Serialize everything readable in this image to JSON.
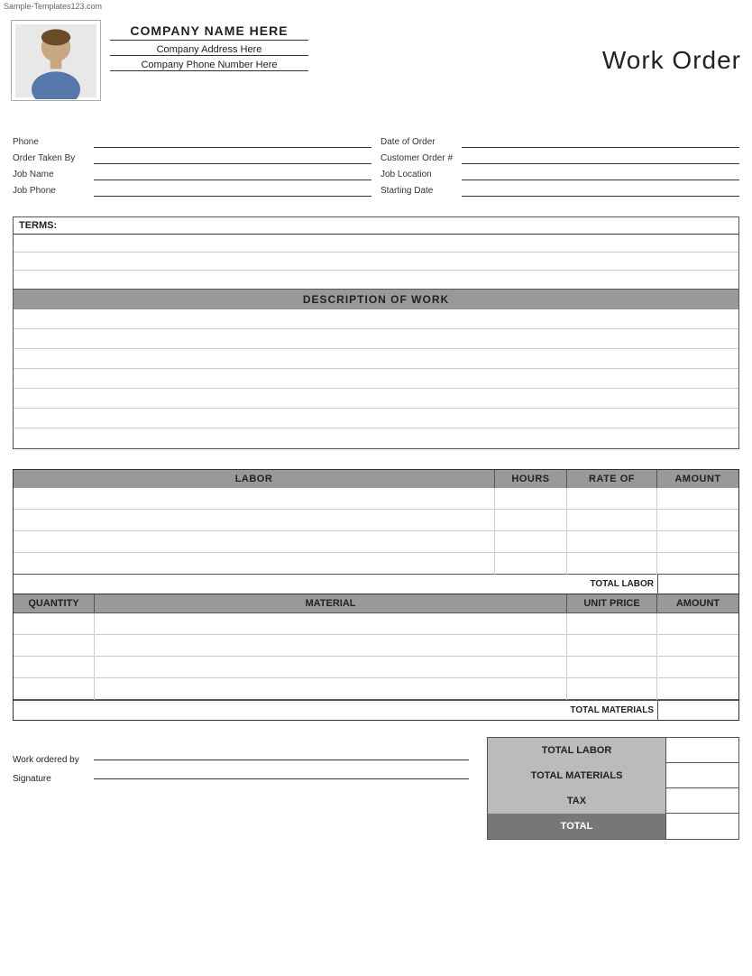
{
  "watermark": "Sample-Templates123.com",
  "header": {
    "company_name": "COMPANY NAME HERE",
    "company_address": "Company Address Here",
    "company_phone": "Company Phone Number Here",
    "title": "Work Order"
  },
  "form": {
    "left": [
      {
        "label": "Phone",
        "value": ""
      },
      {
        "label": "Order Taken By",
        "value": ""
      },
      {
        "label": "Job Name",
        "value": ""
      },
      {
        "label": "Job Phone",
        "value": ""
      }
    ],
    "right": [
      {
        "label": "Date of Order",
        "value": ""
      },
      {
        "label": "Customer Order #",
        "value": ""
      },
      {
        "label": "Job Location",
        "value": ""
      },
      {
        "label": "Starting Date",
        "value": ""
      }
    ]
  },
  "terms": {
    "label": "TERMS:",
    "rows": 3
  },
  "description": {
    "header": "DESCRIPTION OF WORK",
    "rows": 7
  },
  "labor": {
    "columns": [
      "LABOR",
      "HOURS",
      "RATE OF",
      "AMOUNT"
    ],
    "rows": 4,
    "total_label": "TOTAL LABOR"
  },
  "materials": {
    "columns": [
      "QUANTITY",
      "MATERIAL",
      "UNIT PRICE",
      "AMOUNT"
    ],
    "rows": 4,
    "total_label": "TOTAL MATERIALS"
  },
  "summary": {
    "work_ordered_by_label": "Work ordered by",
    "signature_label": "Signature",
    "totals": [
      {
        "label": "TOTAL LABOR",
        "value": ""
      },
      {
        "label": "TOTAL MATERIALS",
        "value": ""
      },
      {
        "label": "TAX",
        "value": ""
      },
      {
        "label": "TOTAL",
        "value": ""
      }
    ]
  }
}
